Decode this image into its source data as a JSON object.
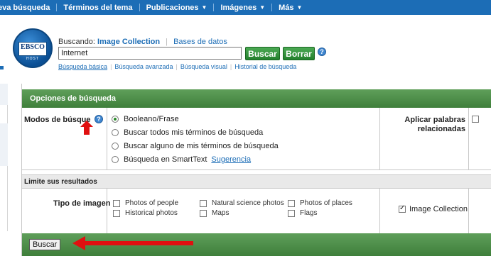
{
  "nav": {
    "items": [
      {
        "label": "eva búsqueda",
        "caret": false
      },
      {
        "label": "Términos del tema",
        "caret": false
      },
      {
        "label": "Publicaciones",
        "caret": true
      },
      {
        "label": "Imágenes",
        "caret": true
      },
      {
        "label": "Más",
        "caret": true
      }
    ]
  },
  "search": {
    "searching_label": "Buscando:",
    "database": "Image Collection",
    "databases_link": "Bases de datos",
    "query": "Internet",
    "search_button": "Buscar",
    "clear_button": "Borrar",
    "links": [
      "Búsqueda básica",
      "Búsqueda avanzada",
      "Búsqueda visual",
      "Historial de búsqueda"
    ],
    "logo_text": "EBSCO",
    "logo_subtext": "HOST"
  },
  "options": {
    "title": "Opciones de búsqueda",
    "modes_label": "Modos de búsque",
    "modes": [
      {
        "label": "Booleano/Frase",
        "selected": true
      },
      {
        "label": "Buscar todos mis términos de búsqueda",
        "selected": false
      },
      {
        "label": "Buscar alguno de mis términos de búsqueda",
        "selected": false
      },
      {
        "label": "Búsqueda en SmartText",
        "selected": false,
        "link": "Sugerencia"
      }
    ],
    "related_words_label": "Aplicar palabras relacionadas",
    "related_words_checked": false
  },
  "limits": {
    "title": "Limite sus resultados",
    "image_type_label": "Tipo de imagen",
    "image_types": [
      {
        "label": "Photos of people",
        "checked": false
      },
      {
        "label": "Natural science photos",
        "checked": false
      },
      {
        "label": "Photos of places",
        "checked": false
      },
      {
        "label": "Historical photos",
        "checked": false
      },
      {
        "label": "Maps",
        "checked": false
      },
      {
        "label": "Flags",
        "checked": false
      }
    ],
    "image_collection": {
      "label": "Image Collection",
      "checked": true
    }
  },
  "footer": {
    "search_button": "Buscar"
  },
  "colors": {
    "nav_blue": "#1c6db6",
    "panel_green": "#4f8f4a",
    "button_green": "#2f8f37",
    "annotation_red": "#e01010"
  }
}
